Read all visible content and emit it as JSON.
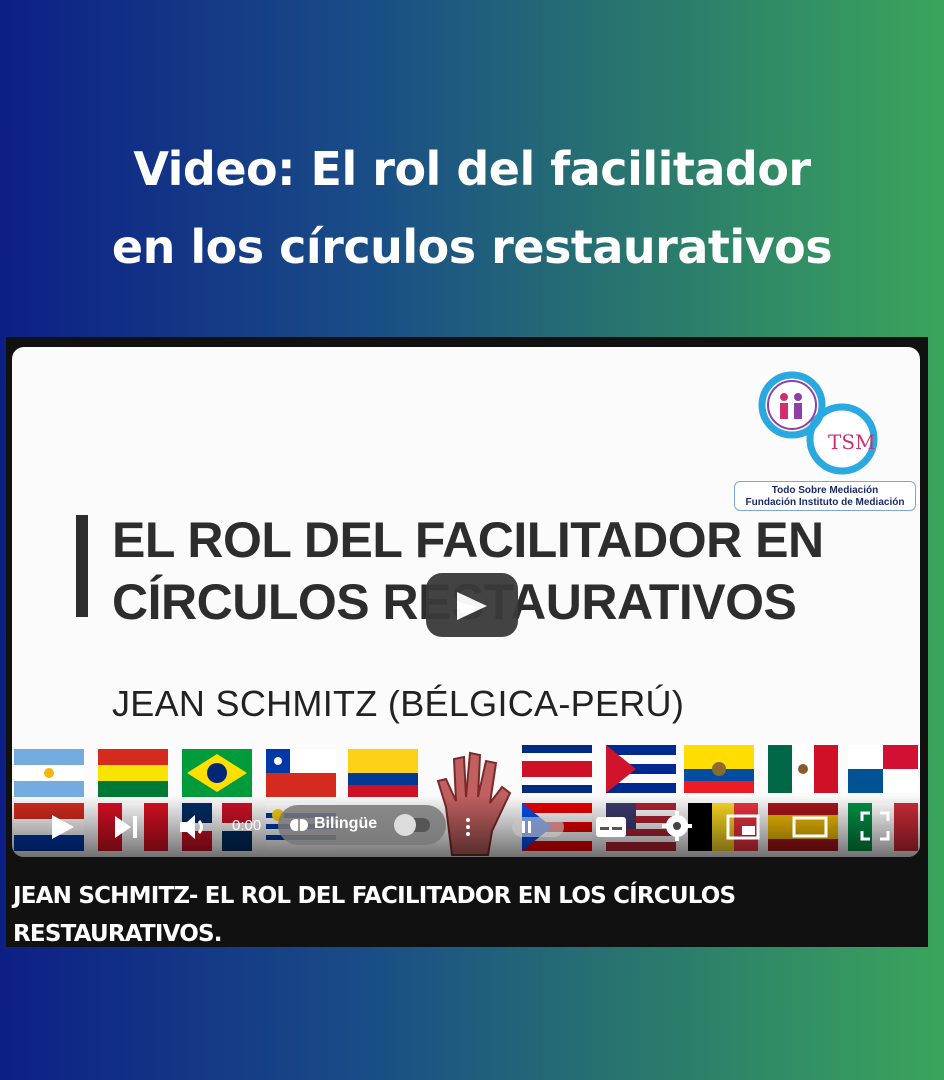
{
  "page": {
    "heading_line1": "Video: El rol del facilitador",
    "heading_line2": "en los círculos restaurativos"
  },
  "video": {
    "title_line1": "EL ROL DEL FACILITADOR EN",
    "title_line2": "CÍRCULOS RESTAURATIVOS",
    "author": "JEAN SCHMITZ (BÉLGICA-PERÚ)",
    "logo_tag_line1": "Todo Sobre Mediación",
    "logo_tag_line2": "Fundación Instituto de Mediación",
    "logo_text": "TSM",
    "caption": "JEAN SCHMITZ- EL ROL DEL FACILITADOR EN LOS CÍRCULOS RESTAURATIVOS."
  },
  "controls": {
    "time": "0:00",
    "bilingue_label": "Bilingüe",
    "icons": [
      "play-icon",
      "next-icon",
      "volume-icon",
      "brain-icon",
      "more-icon",
      "pause-icon",
      "subtitles-icon",
      "settings-icon",
      "miniplayer-icon",
      "theater-icon",
      "fullscreen-icon"
    ]
  },
  "colors": {
    "accent_dark": "#2d2d2d",
    "player_bg": "#111111",
    "gradient_left": "#0d1f86",
    "gradient_right": "#3aa55c"
  }
}
